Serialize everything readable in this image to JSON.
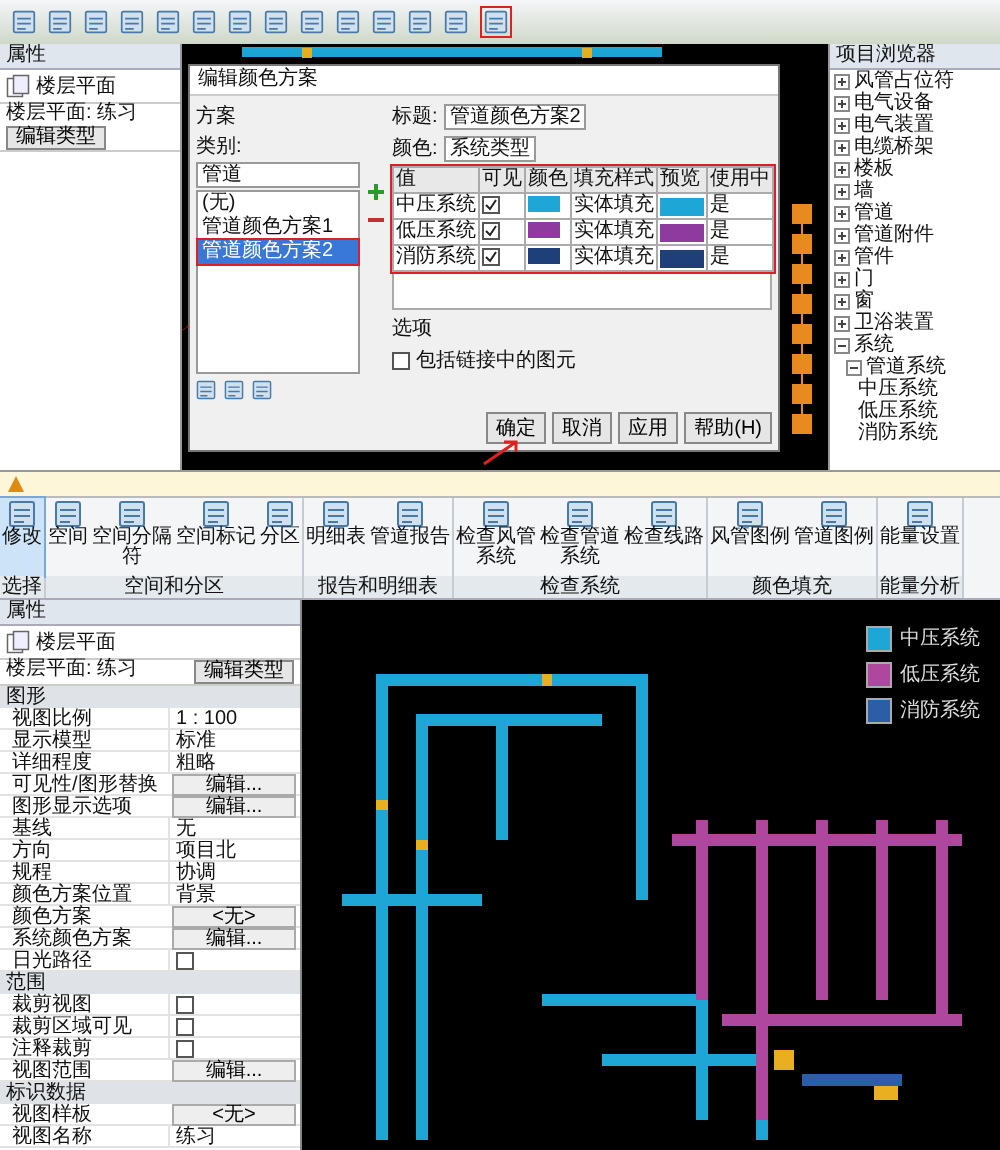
{
  "top_window": {
    "properties": {
      "title": "属性",
      "type": "楼层平面",
      "filter": "楼层平面: 练习",
      "edit_type": "编辑类型"
    },
    "dialog": {
      "title": "编辑颜色方案",
      "scheme_label": "方案",
      "category_label": "类别:",
      "category": "管道",
      "schemes": [
        {
          "label": "(无)",
          "selected": false
        },
        {
          "label": "管道颜色方案1",
          "selected": false
        },
        {
          "label": "管道颜色方案2",
          "selected": true
        }
      ],
      "title_label": "标题:",
      "title_value": "管道颜色方案2",
      "color_label": "颜色:",
      "color_value": "系统类型",
      "columns": [
        "值",
        "可见",
        "颜色",
        "填充样式",
        "预览",
        "使用中"
      ],
      "rows": [
        {
          "value": "中压系统",
          "visible": true,
          "color": "#1ea6d6",
          "fill": "实体填充",
          "in_use": "是"
        },
        {
          "value": "低压系统",
          "visible": true,
          "color": "#8e3a9e",
          "fill": "实体填充",
          "in_use": "是"
        },
        {
          "value": "消防系统",
          "visible": true,
          "color": "#1f3f7a",
          "fill": "实体填充",
          "in_use": "是"
        }
      ],
      "options_label": "选项",
      "option": {
        "label": "包括链接中的图元",
        "checked": false
      },
      "buttons": [
        "确定",
        "取消",
        "应用",
        "帮助(H)"
      ]
    },
    "browser": {
      "title": "项目浏览器",
      "items": [
        {
          "label": "风管占位符",
          "expanded": false
        },
        {
          "label": "电气设备",
          "expanded": false
        },
        {
          "label": "电气装置",
          "expanded": false
        },
        {
          "label": "电缆桥架",
          "expanded": false
        },
        {
          "label": "楼板",
          "expanded": false
        },
        {
          "label": "墙",
          "expanded": false
        },
        {
          "label": "管道",
          "expanded": false
        },
        {
          "label": "管道附件",
          "expanded": false
        },
        {
          "label": "管件",
          "expanded": false
        },
        {
          "label": "门",
          "expanded": false
        },
        {
          "label": "窗",
          "expanded": false
        },
        {
          "label": "卫浴装置",
          "expanded": false
        },
        {
          "label": "系统",
          "expanded": true,
          "children": [
            {
              "label": "管道系统",
              "expanded": true,
              "children": [
                {
                  "label": "中压系统"
                },
                {
                  "label": "低压系统"
                },
                {
                  "label": "消防系统"
                }
              ]
            }
          ]
        }
      ]
    }
  },
  "bottom_window": {
    "ribbon": [
      {
        "label": "选择",
        "buttons": [
          {
            "label": "修改",
            "selected": true
          }
        ]
      },
      {
        "label": "空间和分区",
        "buttons": [
          {
            "label": "空间",
            "selected": false
          },
          {
            "label": "空间分隔符",
            "selected": false
          },
          {
            "label": "空间标记",
            "selected": false
          },
          {
            "label": "分区",
            "selected": false
          }
        ]
      },
      {
        "label": "报告和明细表",
        "buttons": [
          {
            "label": "明细表",
            "selected": false
          },
          {
            "label": "管道报告",
            "selected": false
          }
        ]
      },
      {
        "label": "检查系统",
        "buttons": [
          {
            "label": "检查风管系统",
            "selected": false
          },
          {
            "label": "检查管道系统",
            "selected": false
          },
          {
            "label": "检查线路",
            "selected": false
          }
        ]
      },
      {
        "label": "颜色填充",
        "buttons": [
          {
            "label": "风管图例",
            "selected": false
          },
          {
            "label": "管道图例",
            "selected": false
          }
        ]
      },
      {
        "label": "能量分析",
        "buttons": [
          {
            "label": "能量设置",
            "selected": false
          }
        ]
      }
    ],
    "properties": {
      "title": "属性",
      "type": "楼层平面",
      "filter": "楼层平面: 练习",
      "edit_type": "编辑类型",
      "rows": [
        {
          "kind": "section",
          "label": "图形"
        },
        {
          "kind": "text",
          "label": "视图比例",
          "value": "1 : 100"
        },
        {
          "kind": "text",
          "label": "显示模型",
          "value": "标准"
        },
        {
          "kind": "text",
          "label": "详细程度",
          "value": "粗略"
        },
        {
          "kind": "button",
          "label": "可见性/图形替换",
          "value": "编辑..."
        },
        {
          "kind": "button",
          "label": "图形显示选项",
          "value": "编辑..."
        },
        {
          "kind": "text",
          "label": "基线",
          "value": "无"
        },
        {
          "kind": "text",
          "label": "方向",
          "value": "项目北"
        },
        {
          "kind": "text",
          "label": "规程",
          "value": "协调"
        },
        {
          "kind": "text",
          "label": "颜色方案位置",
          "value": "背景"
        },
        {
          "kind": "button",
          "label": "颜色方案",
          "value": "<无>"
        },
        {
          "kind": "button",
          "label": "系统颜色方案",
          "value": "编辑..."
        },
        {
          "kind": "checkbox",
          "label": "日光路径",
          "checked": false
        },
        {
          "kind": "section",
          "label": "范围"
        },
        {
          "kind": "checkbox",
          "label": "裁剪视图",
          "checked": false
        },
        {
          "kind": "checkbox",
          "label": "裁剪区域可见",
          "checked": false
        },
        {
          "kind": "checkbox",
          "label": "注释裁剪",
          "checked": false
        },
        {
          "kind": "button",
          "label": "视图范围",
          "value": "编辑..."
        },
        {
          "kind": "section",
          "label": "标识数据"
        },
        {
          "kind": "button",
          "label": "视图样板",
          "value": "<无>"
        },
        {
          "kind": "text",
          "label": "视图名称",
          "value": "练习"
        }
      ]
    },
    "legend": [
      {
        "label": "中压系统",
        "color": "#1ea6d6"
      },
      {
        "label": "低压系统",
        "color": "#b0479e"
      },
      {
        "label": "消防系统",
        "color": "#2a5fa8"
      }
    ]
  }
}
